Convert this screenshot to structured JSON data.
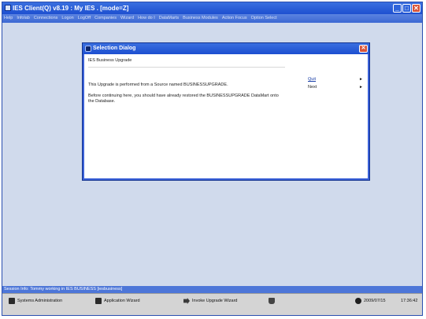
{
  "window": {
    "title": "IES Client(Q) v8.19 : My IES .          [mode=Z]",
    "buttons": [
      "_",
      "□",
      "✕"
    ]
  },
  "menu": [
    "Help",
    "Infolab",
    "Connections",
    "Logon",
    "LogOff",
    "Companies",
    "Wizard",
    "How do I",
    "DataMarts",
    "Business Modules",
    "Action Focus",
    "Option Select"
  ],
  "dialog": {
    "title": "Selection Dialog",
    "heading": "IES Business Upgrade",
    "text1": "This Upgrade is performed from a Source named BUSINESSUPGRADE.",
    "text2": "Before continuing here, you should have already restored the BUSINESSUPGRADE DataMart onto the Database.",
    "options": [
      {
        "label": "Quit",
        "arrow": "►"
      },
      {
        "label": "Next",
        "arrow": "►"
      }
    ],
    "close": "✕"
  },
  "status": "Session Info: Tommy working in IES BUSINESS  [iesbusiness]",
  "taskbar": {
    "items": [
      {
        "label": "Systems Administration",
        "icon": "server-icon"
      },
      {
        "label": "Application Wizard",
        "icon": "wizard-icon"
      },
      {
        "label": "Invoke Upgrade Wizard",
        "icon": "arrow-right-icon"
      },
      {
        "label": "",
        "icon": "database-icon"
      }
    ],
    "date": "2009/07/15",
    "time": "17:36:42"
  }
}
